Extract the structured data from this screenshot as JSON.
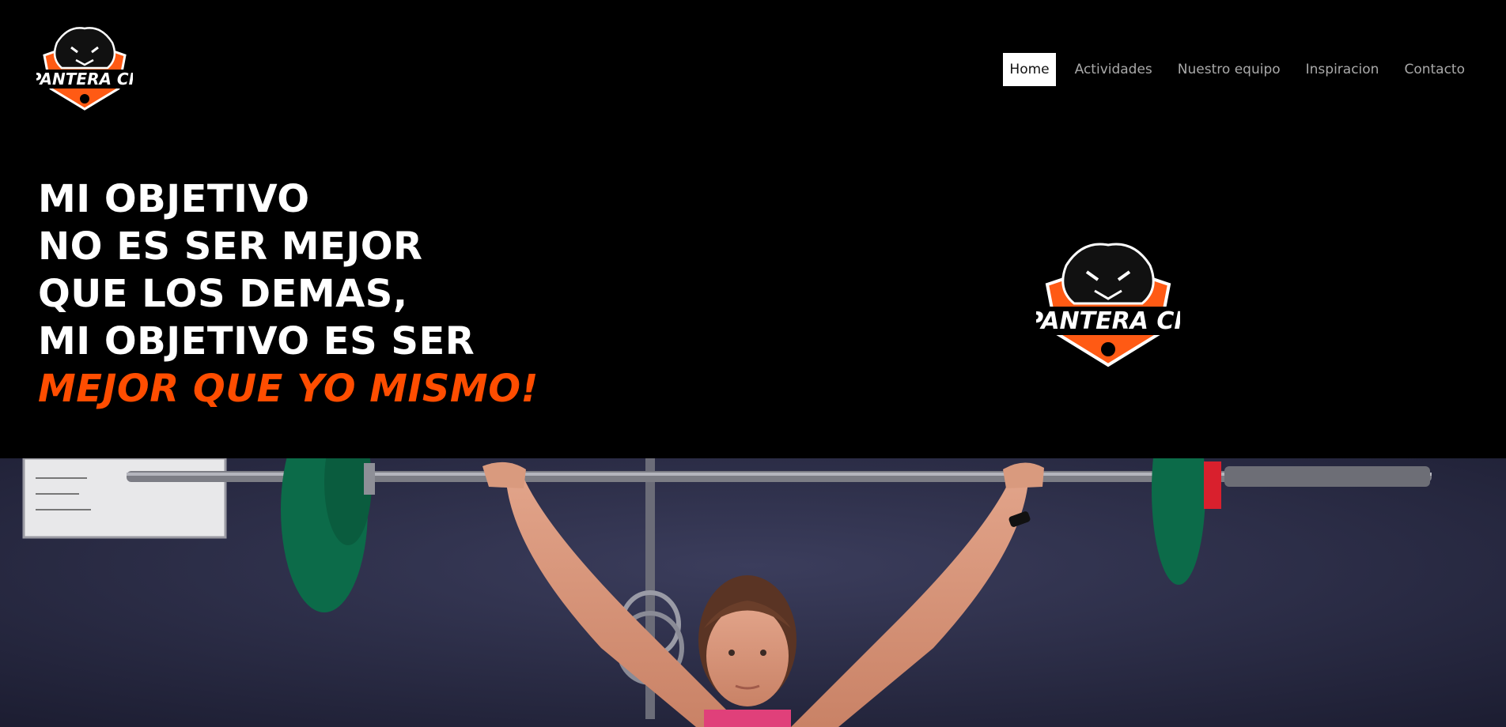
{
  "brand": {
    "logo_text": "PANTERA CF",
    "accent_color": "#ff4d00"
  },
  "nav": {
    "items": [
      {
        "label": "Home",
        "active": true
      },
      {
        "label": "Actividades",
        "active": false
      },
      {
        "label": "Nuestro equipo",
        "active": false
      },
      {
        "label": "Inspiracion",
        "active": false
      },
      {
        "label": "Contacto",
        "active": false
      }
    ]
  },
  "hero": {
    "lines": [
      "MI OBJETIVO",
      "NO ES SER MEJOR",
      "QUE LOS DEMAS,",
      "MI OBJETIVO ES SER"
    ],
    "accent_line": "MEJOR QUE YO MISMO!"
  },
  "photo": {
    "description_icon": "weightlifter-photo"
  }
}
